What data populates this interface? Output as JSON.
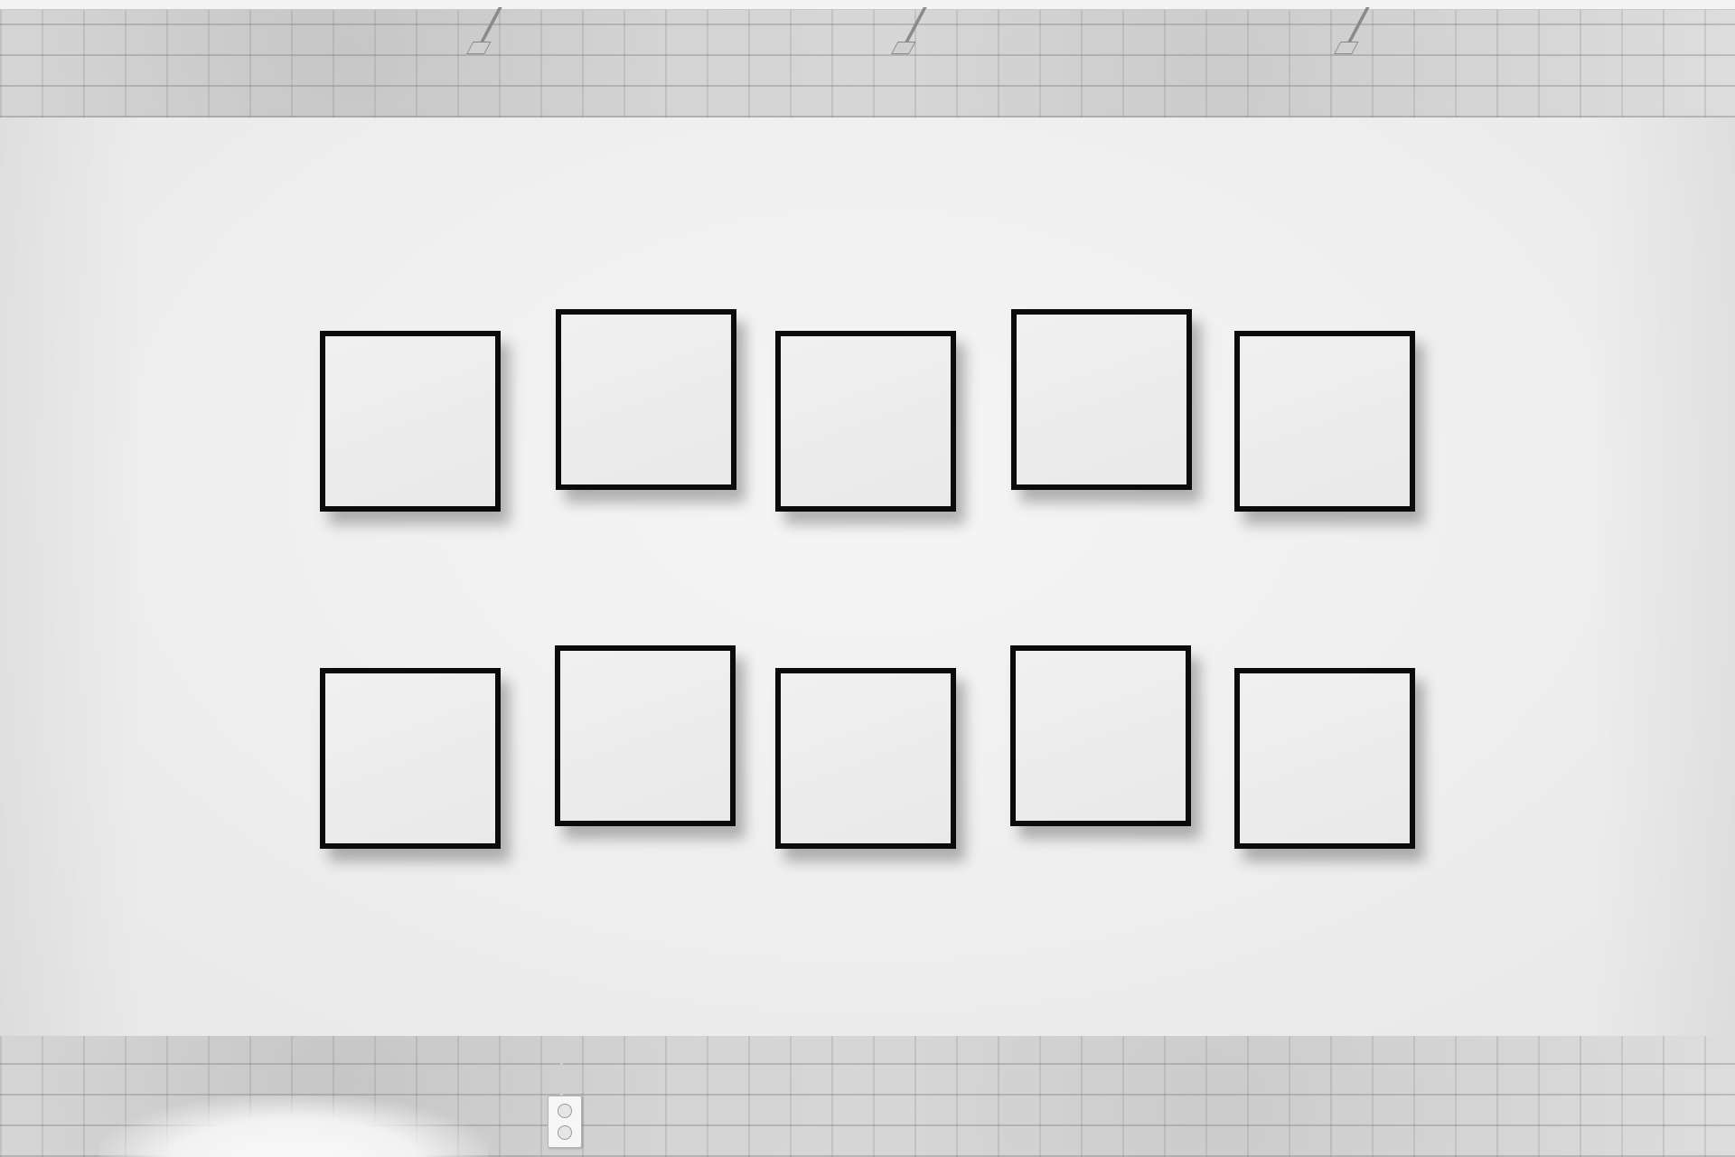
{
  "scene": {
    "description_free": true,
    "colors": {
      "wall": "#efefef",
      "frame_border": "#0b0b0b",
      "frame_inside": "#ececec",
      "brick": "#dedede"
    },
    "icons": [
      "track-light-icon",
      "power-outlet-icon"
    ],
    "frame_rows": [
      {
        "row": "top",
        "count": 5
      },
      {
        "row": "bottom",
        "count": 5
      }
    ]
  }
}
